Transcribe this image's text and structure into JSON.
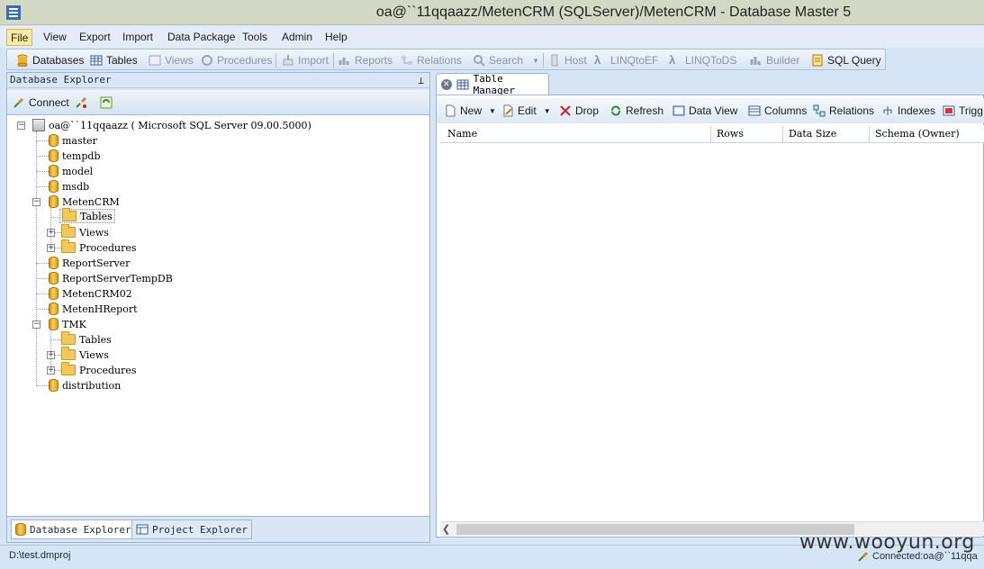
{
  "window": {
    "title": "oa@``11qqaazz/MetenCRM (SQLServer)/MetenCRM - Database Master 5"
  },
  "menu": {
    "items": [
      "File",
      "View",
      "Export",
      "Import",
      "Data Package",
      "Tools",
      "Admin",
      "Help"
    ],
    "active": "File"
  },
  "toolbar": {
    "items": [
      {
        "label": "Databases",
        "icon": "database-icon",
        "enabled": true
      },
      {
        "label": "Tables",
        "icon": "table-icon",
        "enabled": true
      },
      {
        "label": "Views",
        "icon": "view-icon",
        "enabled": false
      },
      {
        "label": "Procedures",
        "icon": "procedure-icon",
        "enabled": false
      },
      {
        "label": "Import",
        "icon": "import-icon",
        "enabled": false
      },
      {
        "label": "Reports",
        "icon": "reports-icon",
        "enabled": false
      },
      {
        "label": "Relations",
        "icon": "relations-icon",
        "enabled": false
      },
      {
        "label": "Search",
        "icon": "search-icon",
        "enabled": false
      },
      {
        "label": "Host",
        "icon": "host-icon",
        "enabled": false
      },
      {
        "label": "LINQtoEF",
        "icon": "lambda-icon",
        "enabled": false
      },
      {
        "label": "LINQToDS",
        "icon": "lambda-icon",
        "enabled": false
      },
      {
        "label": "Builder",
        "icon": "builder-icon",
        "enabled": false
      },
      {
        "label": "SQL Query",
        "icon": "sql-query-icon",
        "enabled": true
      }
    ]
  },
  "explorer": {
    "title": "Database Explorer",
    "connect_label": "Connect",
    "server": "oa@``11qqaazz ( Microsoft SQL Server  09.00.5000)",
    "nodes": {
      "master": "master",
      "tempdb": "tempdb",
      "model": "model",
      "msdb": "msdb",
      "metencrm": "MetenCRM",
      "metencrm_tables": "Tables",
      "metencrm_views": "Views",
      "metencrm_procedures": "Procedures",
      "reportserver": "ReportServer",
      "reportservertempdb": "ReportServerTempDB",
      "metencrm02": "MetenCRM02",
      "metenhreport": "MetenHReport",
      "tmk": "TMK",
      "tmk_tables": "Tables",
      "tmk_views": "Views",
      "tmk_procedures": "Procedures",
      "distribution": "distribution"
    },
    "bottom_tabs": [
      "Database Explorer",
      "Project Explorer"
    ]
  },
  "table_manager": {
    "tab_title": "Table Manager",
    "toolbar": {
      "new": "New",
      "edit": "Edit",
      "drop": "Drop",
      "refresh": "Refresh",
      "data_view": "Data View",
      "columns": "Columns",
      "relations": "Relations",
      "indexes": "Indexes",
      "triggers": "Trigg"
    },
    "columns": [
      "Name",
      "Rows",
      "Data Size",
      "Schema (Owner)"
    ],
    "rows": []
  },
  "status": {
    "project_path": "D:\\test.dmproj",
    "connection": "Connected:oa@``11qqa"
  },
  "watermark": "www.wooyun.org",
  "colors": {
    "accent": "#d6e5f5",
    "menu_active": "#fbe9a4",
    "title_bar": "#d3d9c5"
  }
}
